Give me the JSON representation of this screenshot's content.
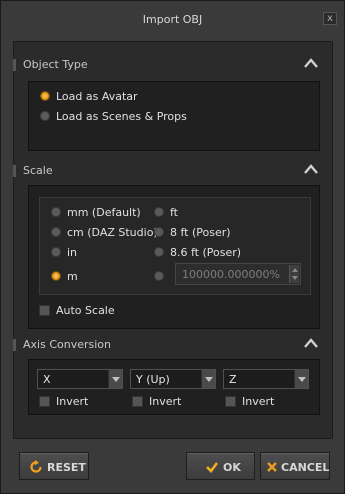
{
  "window": {
    "title": "Import OBJ",
    "close_glyph": "x"
  },
  "object_type": {
    "header": "Object Type",
    "options": [
      {
        "label": "Load as Avatar",
        "selected": true
      },
      {
        "label": "Load as Scenes & Props",
        "selected": false
      }
    ]
  },
  "scale": {
    "header": "Scale",
    "left_options": [
      {
        "label": "mm (Default)",
        "selected": false
      },
      {
        "label": "cm (DAZ Studio)",
        "selected": false
      },
      {
        "label": "in",
        "selected": false
      },
      {
        "label": "m",
        "selected": true
      }
    ],
    "right_options": [
      {
        "label": "ft",
        "selected": false
      },
      {
        "label": "8 ft (Poser)",
        "selected": false
      },
      {
        "label": "8.6 ft (Poser)",
        "selected": false
      }
    ],
    "custom_value": "100000.000000%",
    "auto_scale_label": "Auto Scale"
  },
  "axis_conversion": {
    "header": "Axis Conversion",
    "axes": [
      {
        "value": "X",
        "invert_label": "Invert"
      },
      {
        "value": "Y (Up)",
        "invert_label": "Invert"
      },
      {
        "value": "Z",
        "invert_label": "Invert"
      }
    ]
  },
  "buttons": {
    "reset": "RESET",
    "ok": "OK",
    "cancel": "CANCEL"
  },
  "colors": {
    "accent_orange": "#f0a020",
    "ok_check": "#f0b020",
    "cancel_x": "#e8a020"
  }
}
